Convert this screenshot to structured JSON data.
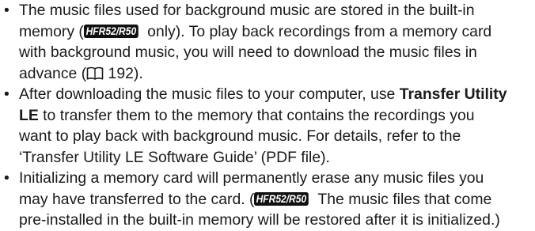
{
  "bullet_glyph": "•",
  "model_badge": "HFR52/R50",
  "icon": "book-reference-icon",
  "items": [
    {
      "l1": "The music files used for background music are stored in the built-in",
      "l2_a": "memory (",
      "l2_b": " only). To play back recordings from a memory card",
      "l3": "with background music, you will need to download the music files in",
      "l4_a": "advance (",
      "l4_b": " 192)."
    },
    {
      "l1_a": "After downloading the music files to your computer, use ",
      "l1_bold": "Transfer Utility",
      "l2_bold": "LE",
      "l2_b": " to transfer them to the memory that contains the recordings you",
      "l3": "want to play back with background music. For details, refer to the",
      "l4": "‘Transfer Utility LE Software Guide’ (PDF file)."
    },
    {
      "l1": "Initializing a memory card will permanently erase any music files you",
      "l2_a": "may have transferred to the card. (",
      "l2_b": " The music files that come",
      "l3": "pre-installed in the built-in memory will be restored after it is initialized.)"
    }
  ]
}
